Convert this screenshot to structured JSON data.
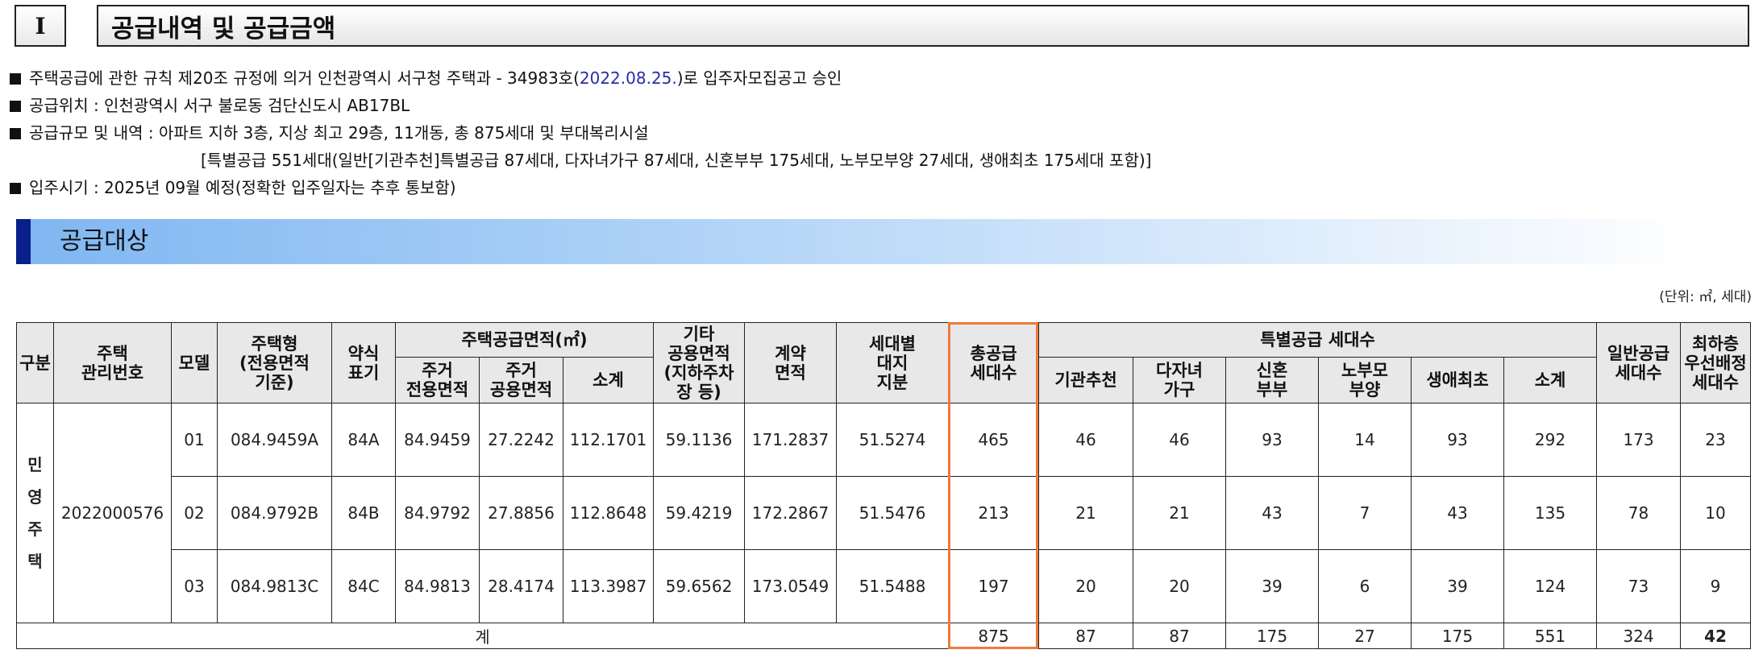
{
  "section": {
    "number": "I",
    "title": "공급내역 및 공급금액"
  },
  "bullets": {
    "b1_pre": "주택공급에 관한 규칙 제20조 규정에 의거 인천광역시 서구청 주택과 - 34983호(",
    "b1_date": "2022.08.25.",
    "b1_post": ")로 입주자모집공고 승인",
    "b2": "공급위치 : 인천광역시 서구 불로동 검단신도시 AB17BL",
    "b3": "공급규모 및 내역 : 아파트 지하 3층, 지상 최고 29층, 11개동, 총 875세대 및 부대복리시설",
    "b3_cont": "[특별공급 551세대(일반[기관추천]특별공급 87세대, 다자녀가구 87세대, 신혼부부 175세대, 노부모부양 27세대, 생애최초 175세대 포함)]",
    "b4": "입주시기 : 2025년 09월 예정(정확한 입주일자는 추후 통보함)"
  },
  "subheader": "공급대상",
  "unit": "(단위: ㎡, 세대)",
  "headers": {
    "gubun": "구분",
    "mgmt": "주택\n관리번호",
    "model": "모델",
    "type": "주택형\n(전용면적\n기준)",
    "abbr": "약식\n표기",
    "supply_area": "주택공급면적(㎡)",
    "excl": "주거\n전용면적",
    "common": "주거\n공용면적",
    "subtotal": "소계",
    "other": "기타\n공용면적\n(지하주차\n장 등)",
    "contract": "계약\n면적",
    "land": "세대별\n대지\n지분",
    "total_supply": "총공급\n세대수",
    "special": "특별공급 세대수",
    "sp_inst": "기관추천",
    "sp_multi": "다자녀\n가구",
    "sp_newlywed": "신혼\n부부",
    "sp_elder": "노부모\n부양",
    "sp_first": "생애최초",
    "sp_sub": "소계",
    "general": "일반공급\n세대수",
    "top_floor": "최하층\n우선배정\n세대수"
  },
  "table": {
    "gubun_label": "민\n영\n주\n택",
    "mgmt_no": "2022000576",
    "rows": [
      {
        "model": "01",
        "type": "084.9459A",
        "abbr": "84A",
        "excl": "84.9459",
        "common": "27.2242",
        "sub": "112.1701",
        "other": "59.1136",
        "contract": "171.2837",
        "land": "51.5274",
        "total": "465",
        "inst": "46",
        "multi": "46",
        "newlywed": "93",
        "elder": "14",
        "first": "93",
        "sp_sub": "292",
        "general": "173",
        "top": "23"
      },
      {
        "model": "02",
        "type": "084.9792B",
        "abbr": "84B",
        "excl": "84.9792",
        "common": "27.8856",
        "sub": "112.8648",
        "other": "59.4219",
        "contract": "172.2867",
        "land": "51.5476",
        "total": "213",
        "inst": "21",
        "multi": "21",
        "newlywed": "43",
        "elder": "7",
        "first": "43",
        "sp_sub": "135",
        "general": "78",
        "top": "10"
      },
      {
        "model": "03",
        "type": "084.9813C",
        "abbr": "84C",
        "excl": "84.9813",
        "common": "28.4174",
        "sub": "113.3987",
        "other": "59.6562",
        "contract": "173.0549",
        "land": "51.5488",
        "total": "197",
        "inst": "20",
        "multi": "20",
        "newlywed": "39",
        "elder": "6",
        "first": "39",
        "sp_sub": "124",
        "general": "73",
        "top": "9"
      }
    ],
    "total": {
      "label": "계",
      "total": "875",
      "inst": "87",
      "multi": "87",
      "newlywed": "175",
      "elder": "27",
      "first": "175",
      "sp_sub": "551",
      "general": "324",
      "top": "42"
    }
  },
  "colors": {
    "highlight_border": "#ee7a3c",
    "totals_blue": "#1420b8",
    "mgmt_purple": "#3a36a6",
    "subheader_mark": "#0a1f8a"
  }
}
